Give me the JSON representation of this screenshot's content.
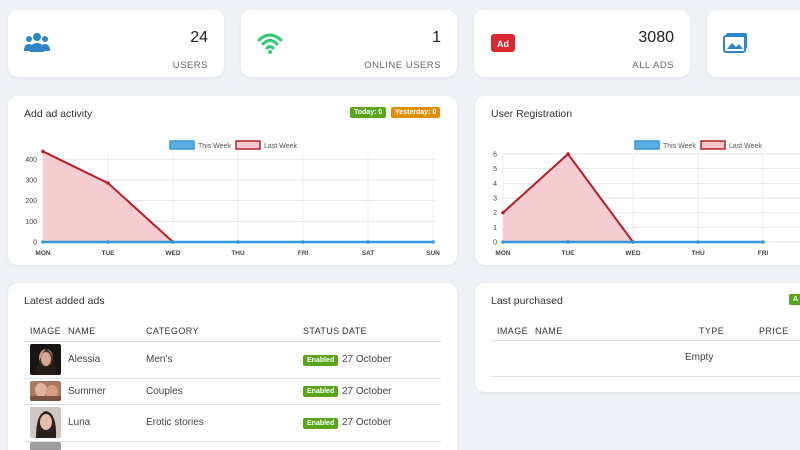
{
  "stats": [
    {
      "value": "24",
      "label": "USERS",
      "icon": "users-icon",
      "color": "#2e86c7"
    },
    {
      "value": "1",
      "label": "ONLINE USERS",
      "icon": "wifi-icon",
      "color": "#2ecc71"
    },
    {
      "value": "3080",
      "label": "ALL ADS",
      "icon": "ad-icon",
      "color": "#d9262f"
    },
    {
      "value": "",
      "label": "",
      "icon": "images-icon",
      "color": "#2e86c7"
    }
  ],
  "ad_activity": {
    "title": "Add ad activity",
    "badge_today": "Today: 0",
    "badge_yesterday": "Yesterday: 0"
  },
  "user_registration": {
    "title": "User Registration"
  },
  "chart_data": [
    {
      "type": "area",
      "title": "Add ad activity",
      "categories": [
        "MON",
        "TUE",
        "WED",
        "THU",
        "FRI",
        "SAT",
        "SUN"
      ],
      "series": [
        {
          "name": "This Week",
          "values": [
            0,
            0,
            0,
            0,
            0,
            0,
            0
          ],
          "color": "#3498db"
        },
        {
          "name": "Last Week",
          "values": [
            438,
            285,
            0,
            null,
            null,
            null,
            null
          ],
          "color": "#b3202a"
        }
      ],
      "yticks": [
        "0",
        "100",
        "200",
        "300",
        "400"
      ],
      "ylim": [
        0,
        440
      ],
      "legend": "top-center",
      "grid": true
    },
    {
      "type": "area",
      "title": "User Registration",
      "categories": [
        "MON",
        "TUE",
        "WED",
        "THU",
        "FRI"
      ],
      "series": [
        {
          "name": "This Week",
          "values": [
            0,
            0,
            0,
            0,
            0
          ],
          "color": "#3498db"
        },
        {
          "name": "Last Week",
          "values": [
            2,
            6,
            0,
            null,
            null
          ],
          "color": "#b3202a"
        }
      ],
      "yticks": [
        "0",
        "1",
        "2",
        "3",
        "4",
        "5",
        "6"
      ],
      "ylim": [
        0,
        6
      ],
      "legend": "top-center",
      "grid": true
    }
  ],
  "latest_ads": {
    "title": "Latest added ads",
    "columns": [
      "IMAGE",
      "NAME",
      "CATEGORY",
      "STATUS",
      "DATE"
    ],
    "rows": [
      {
        "name": "Alessia",
        "category": "Men's",
        "status": "Enabled",
        "date": "27 October"
      },
      {
        "name": "Summer",
        "category": "Couples",
        "status": "Enabled",
        "date": "27 October"
      },
      {
        "name": "Luna",
        "category": "Erotic stories",
        "status": "Enabled",
        "date": "27 October"
      }
    ]
  },
  "last_purchased": {
    "title": "Last purchased",
    "badge": "A",
    "columns": [
      "IMAGE",
      "NAME",
      "TYPE",
      "PRICE"
    ],
    "empty": "Empty"
  }
}
